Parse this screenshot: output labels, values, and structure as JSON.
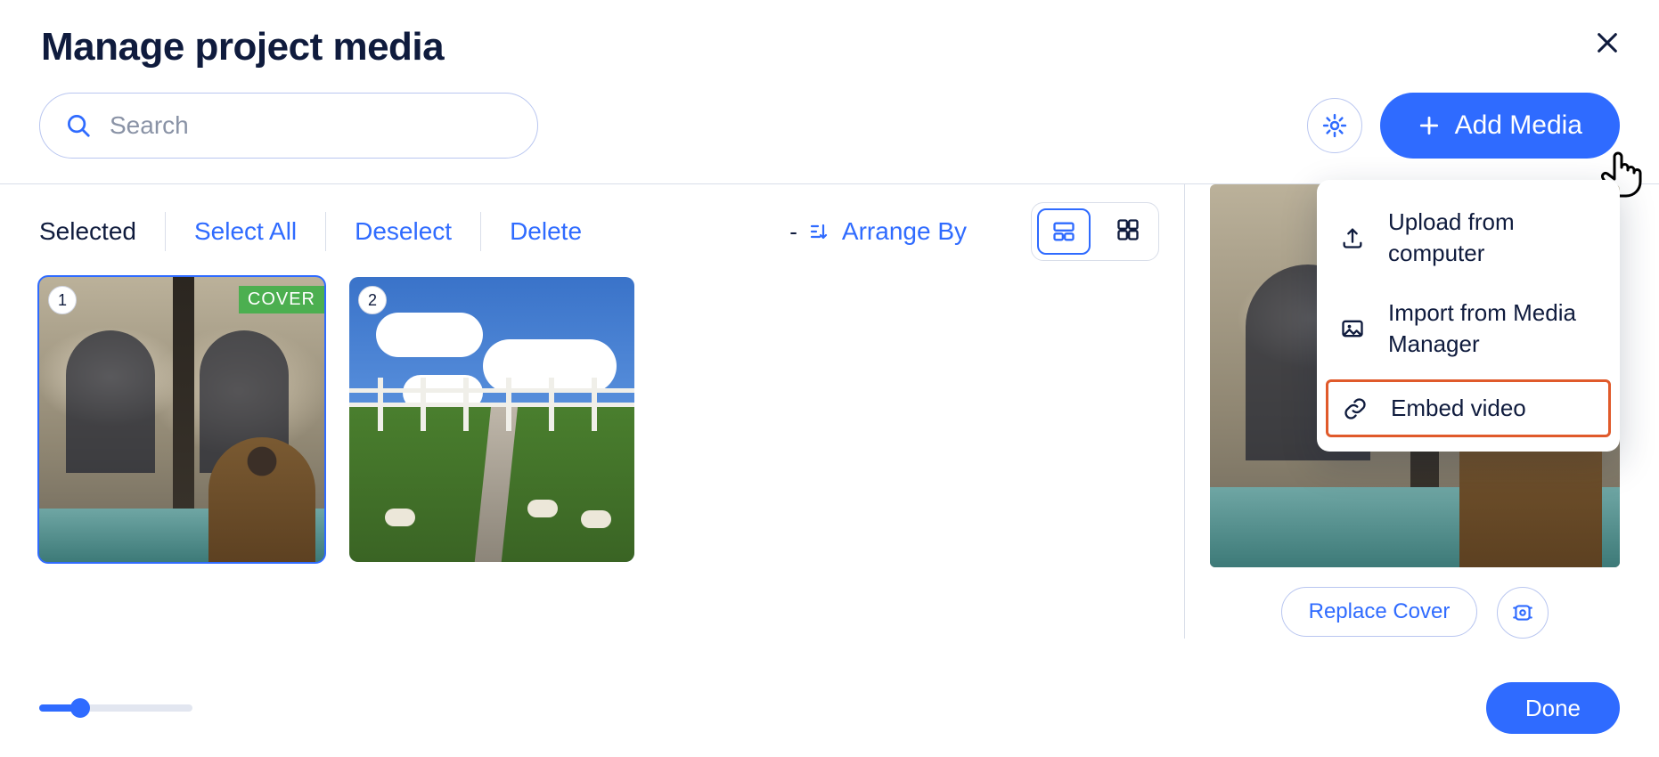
{
  "title": "Manage project media",
  "search": {
    "placeholder": "Search",
    "value": ""
  },
  "header": {
    "add_media": "Add Media"
  },
  "toolbar": {
    "selected": "Selected",
    "select_all": "Select All",
    "deselect": "Deselect",
    "delete": "Delete",
    "arrange_by": "Arrange By"
  },
  "items": [
    {
      "order": "1",
      "cover_label": "COVER",
      "is_cover": true,
      "selected": true
    },
    {
      "order": "2",
      "is_cover": false,
      "selected": false
    }
  ],
  "dropdown": {
    "upload": "Upload from computer",
    "import": "Import from Media Manager",
    "embed": "Embed video"
  },
  "right_panel": {
    "replace_cover": "Replace Cover"
  },
  "footer": {
    "done": "Done"
  }
}
